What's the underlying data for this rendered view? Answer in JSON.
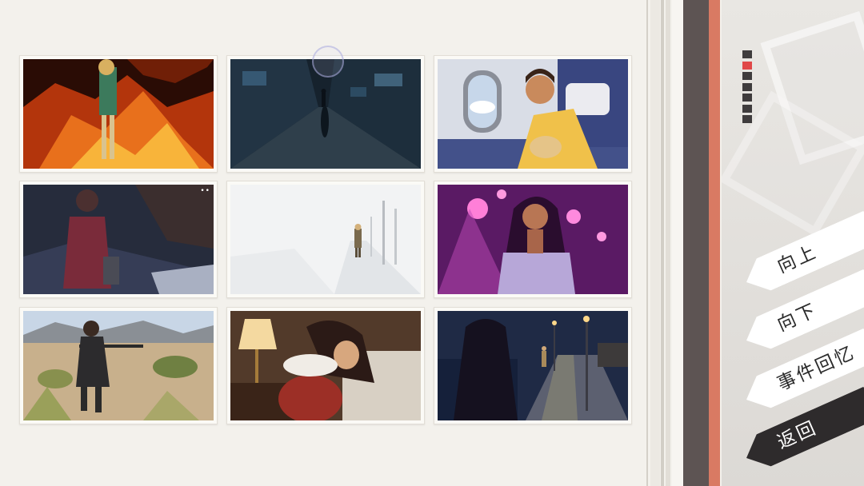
{
  "gallery": {
    "items": [
      {
        "name": "burning-city-scene"
      },
      {
        "name": "dark-alley-figure-scene"
      },
      {
        "name": "airplane-window-man-scene"
      },
      {
        "name": "dim-room-woman-scene",
        "badge": "••"
      },
      {
        "name": "snowy-street-scene"
      },
      {
        "name": "neon-stage-singer-scene"
      },
      {
        "name": "desert-sniper-scene"
      },
      {
        "name": "lamp-sleeping-woman-scene"
      },
      {
        "name": "night-seaside-road-scene"
      }
    ]
  },
  "page_indicator": {
    "count": 7,
    "active_index": 2,
    "active_color": "#e04848",
    "inactive_color": "#3f3c3d"
  },
  "menu": {
    "up_label": "向上",
    "down_label": "向下",
    "recall_label": "事件回忆",
    "back_label": "返回"
  },
  "colors": {
    "accent_stripe": "#d97a63",
    "dark_stripe": "#5d5453",
    "background": "#f3f1ec"
  }
}
